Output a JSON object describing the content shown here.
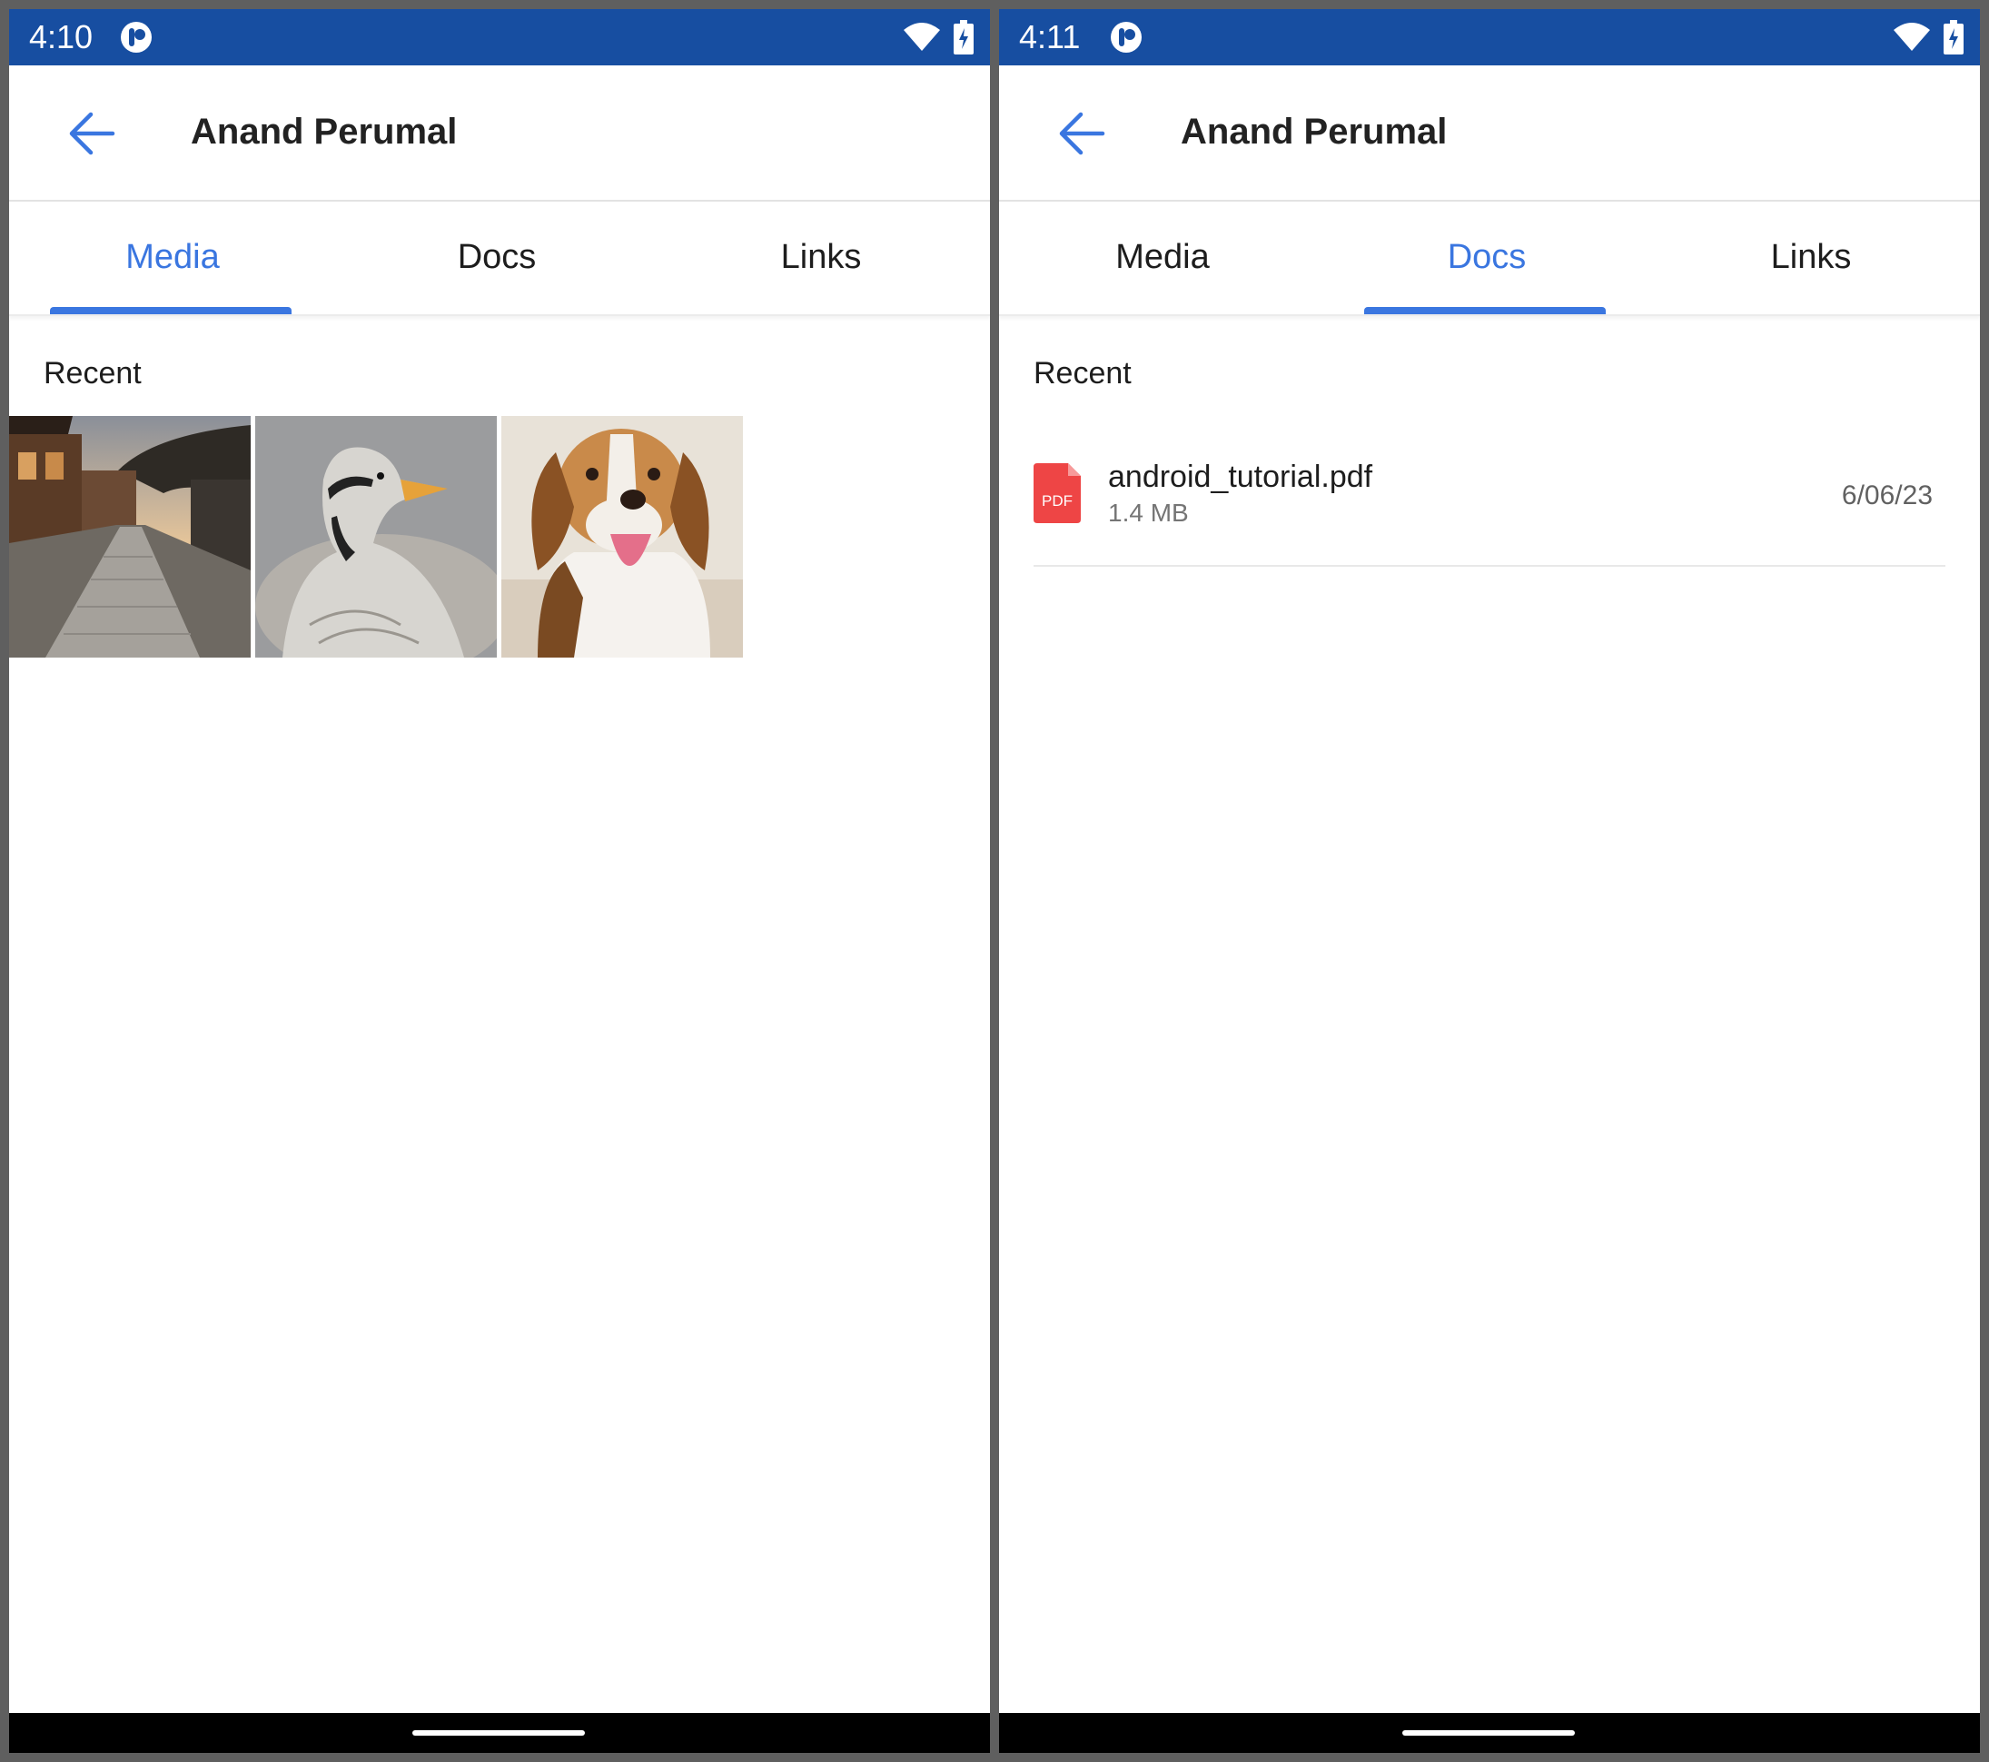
{
  "screens": [
    {
      "status": {
        "time": "4:10"
      },
      "title": "Anand Perumal",
      "tabs": [
        {
          "label": "Media",
          "active": true
        },
        {
          "label": "Docs",
          "active": false
        },
        {
          "label": "Links",
          "active": false
        }
      ],
      "section_header": "Recent",
      "media": [
        {
          "subject": "village street at sunset"
        },
        {
          "subject": "bar-headed goose"
        },
        {
          "subject": "beagle dog"
        }
      ]
    },
    {
      "status": {
        "time": "4:11"
      },
      "title": "Anand Perumal",
      "tabs": [
        {
          "label": "Media",
          "active": false
        },
        {
          "label": "Docs",
          "active": true
        },
        {
          "label": "Links",
          "active": false
        }
      ],
      "section_header": "Recent",
      "docs": [
        {
          "name": "android_tutorial.pdf",
          "size": "1.4 MB",
          "date": "6/06/23",
          "icon_text": "PDF"
        }
      ]
    }
  ],
  "icons": {
    "back": "arrow-left-icon",
    "status_app": "app-notification-icon",
    "wifi": "wifi-icon",
    "battery": "battery-charging-icon",
    "doc": "pdf-file-icon"
  },
  "colors": {
    "status_bar": "#174ea1",
    "accent": "#3a76e0",
    "pdf_red": "#ee4545"
  }
}
